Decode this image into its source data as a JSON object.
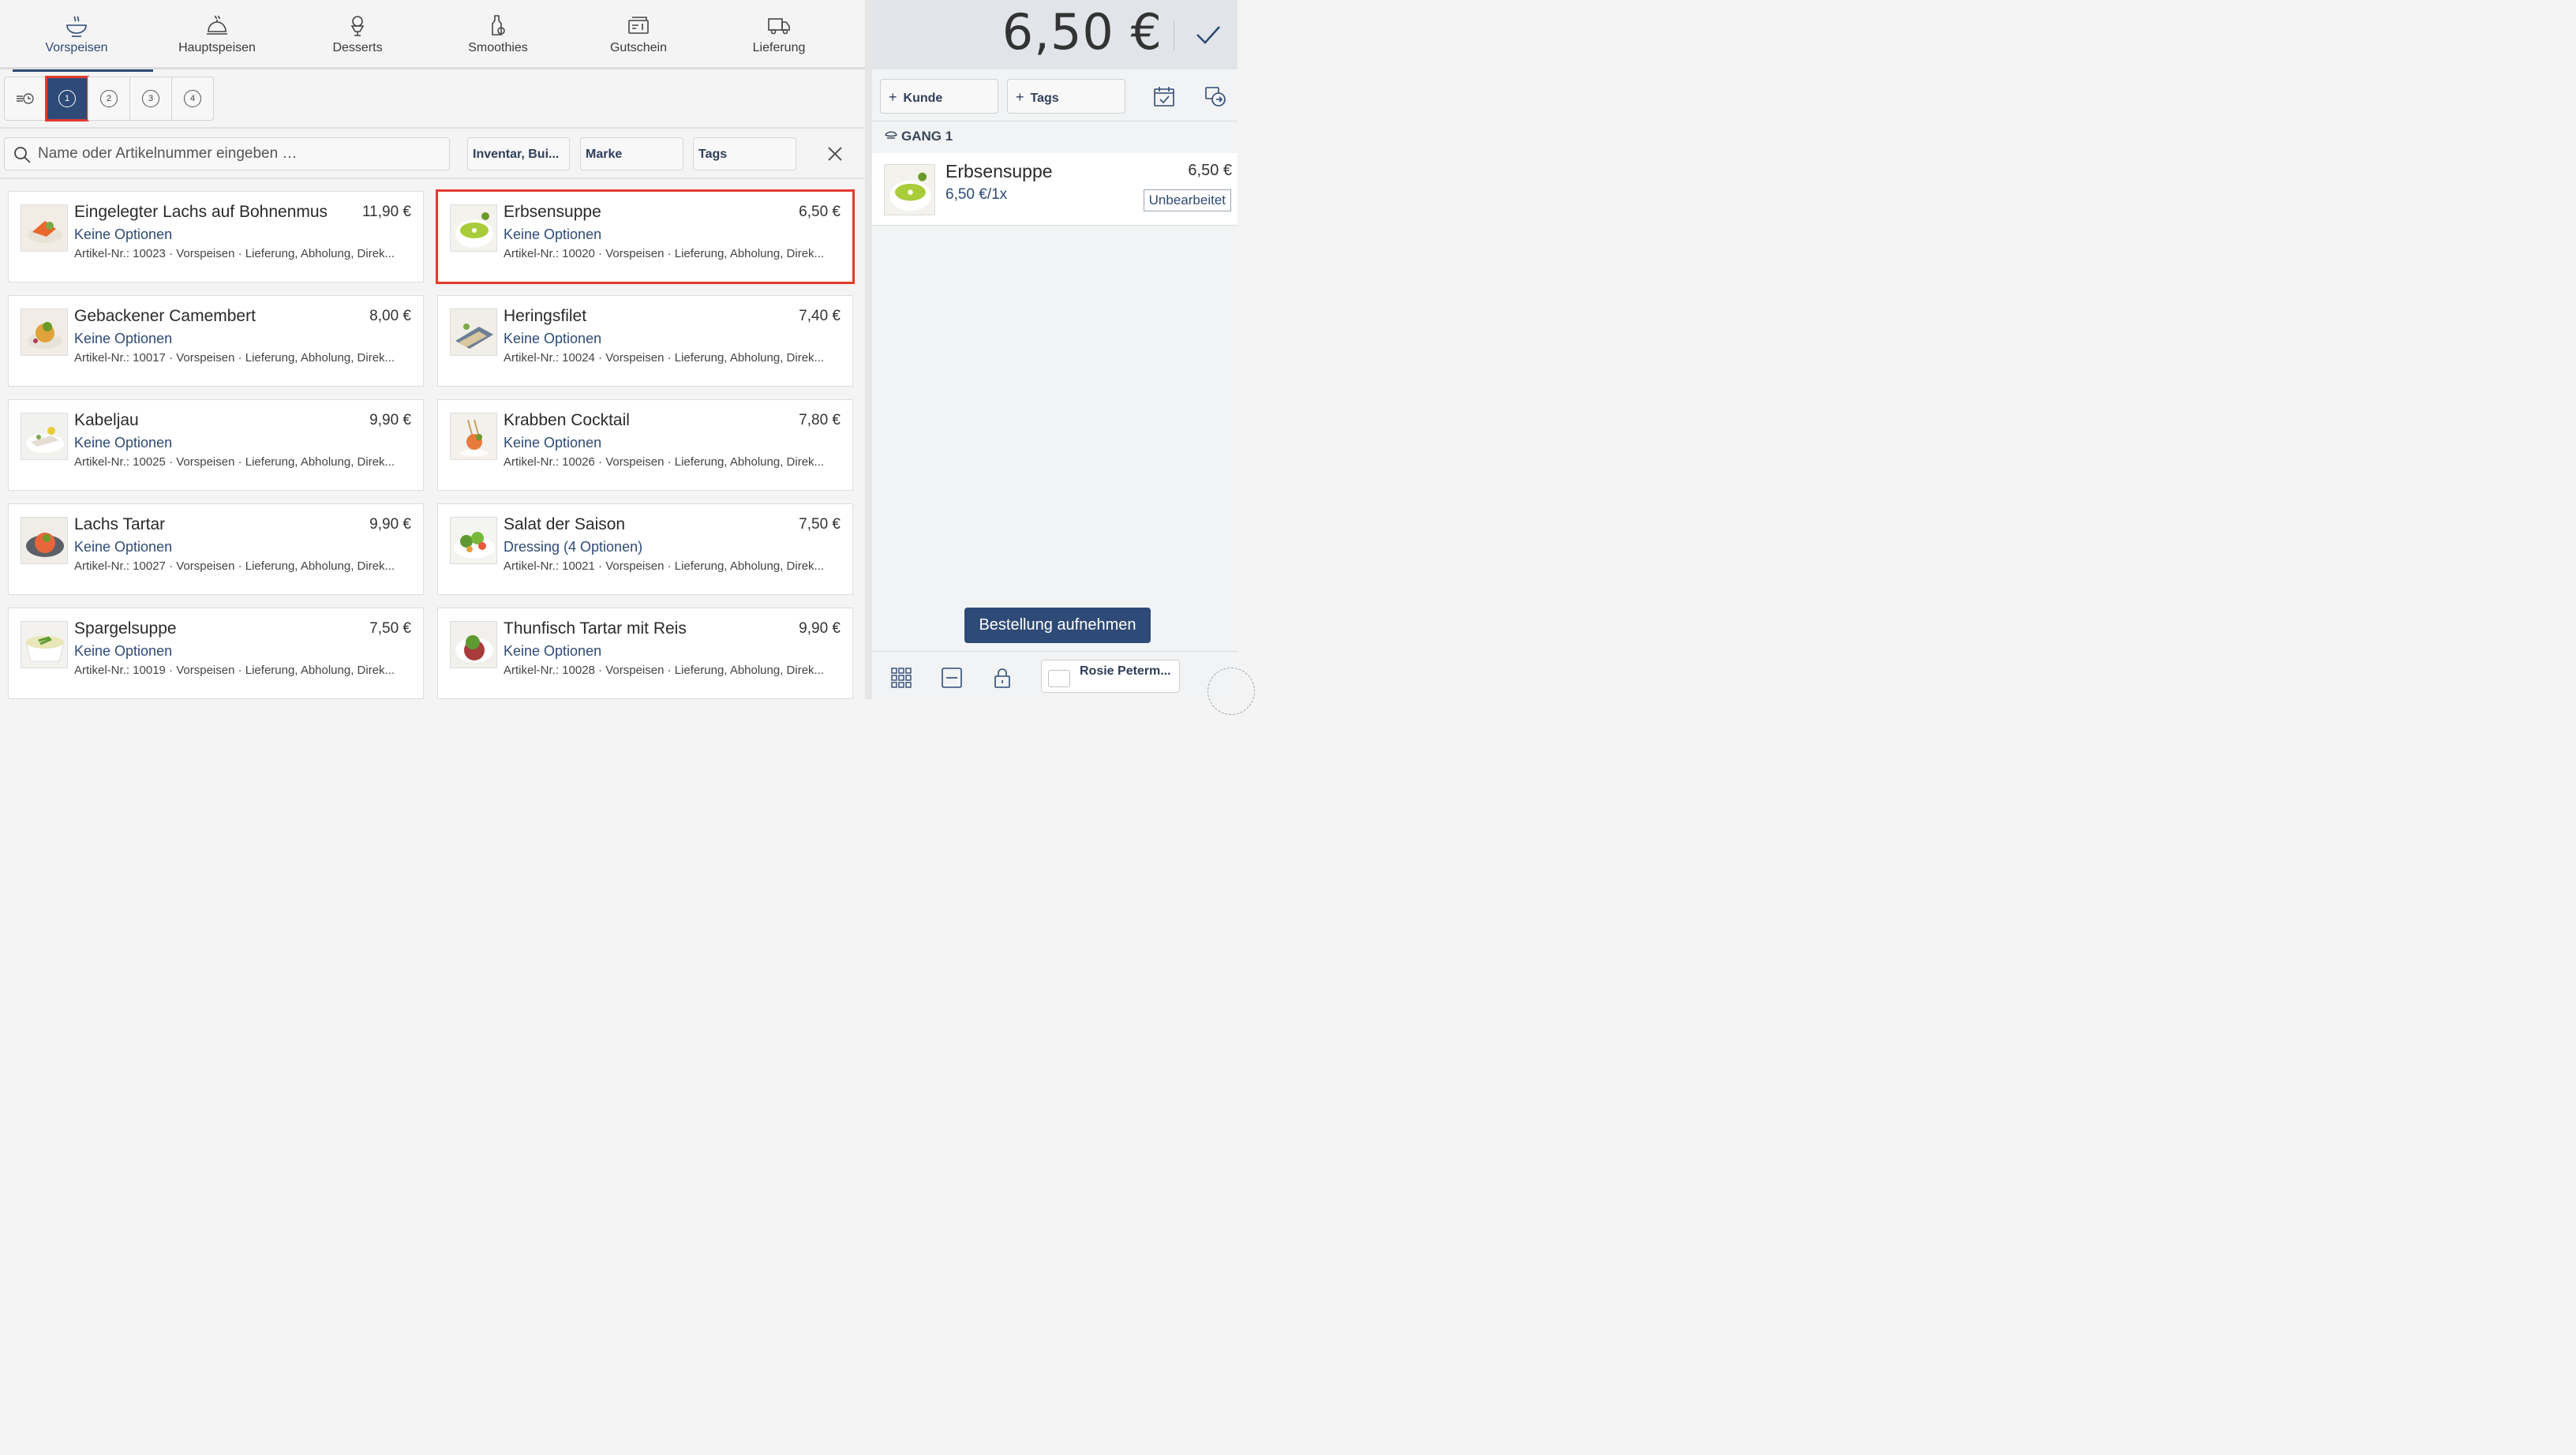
{
  "tabs": [
    {
      "label": "Vorspeisen",
      "icon": "soup-bowl-icon"
    },
    {
      "label": "Hauptspeisen",
      "icon": "cloche-icon"
    },
    {
      "label": "Desserts",
      "icon": "dessert-icon"
    },
    {
      "label": "Smoothies",
      "icon": "bottle-icon"
    },
    {
      "label": "Gutschein",
      "icon": "voucher-icon"
    },
    {
      "label": "Lieferung",
      "icon": "delivery-truck-icon"
    }
  ],
  "courses": [
    {
      "label": "",
      "icon": "list-clock-icon"
    },
    {
      "label": "1"
    },
    {
      "label": "2"
    },
    {
      "label": "3"
    },
    {
      "label": "4"
    }
  ],
  "search": {
    "placeholder": "Name oder Artikelnummer eingeben …"
  },
  "filters": {
    "category": "Inventar, Bui...",
    "brand": "Marke",
    "tags": "Tags"
  },
  "products": [
    {
      "name": "Eingelegter Lachs auf Bohnenmus",
      "price": "11,90 €",
      "options": "Keine Optionen",
      "meta": "Artikel-Nr.: 10023 · Vorspeisen · Lieferung, Abholung, Direk..."
    },
    {
      "name": "Erbsensuppe",
      "price": "6,50 €",
      "options": "Keine Optionen",
      "meta": "Artikel-Nr.: 10020 · Vorspeisen · Lieferung, Abholung, Direk..."
    },
    {
      "name": "Gebackener Camembert",
      "price": "8,00 €",
      "options": "Keine Optionen",
      "meta": "Artikel-Nr.: 10017 · Vorspeisen · Lieferung, Abholung, Direk..."
    },
    {
      "name": "Heringsfilet",
      "price": "7,40 €",
      "options": "Keine Optionen",
      "meta": "Artikel-Nr.: 10024 · Vorspeisen · Lieferung, Abholung, Direk..."
    },
    {
      "name": "Kabeljau",
      "price": "9,90 €",
      "options": "Keine Optionen",
      "meta": "Artikel-Nr.: 10025 · Vorspeisen · Lieferung, Abholung, Direk..."
    },
    {
      "name": "Krabben Cocktail",
      "price": "7,80 €",
      "options": "Keine Optionen",
      "meta": "Artikel-Nr.: 10026 · Vorspeisen · Lieferung, Abholung, Direk..."
    },
    {
      "name": "Lachs Tartar",
      "price": "9,90 €",
      "options": "Keine Optionen",
      "meta": "Artikel-Nr.: 10027 · Vorspeisen · Lieferung, Abholung, Direk..."
    },
    {
      "name": "Salat der Saison",
      "price": "7,50 €",
      "options": "Dressing (4 Optionen)",
      "meta": "Artikel-Nr.: 10021 · Vorspeisen · Lieferung, Abholung, Direk..."
    },
    {
      "name": "Spargelsuppe",
      "price": "7,50 €",
      "options": "Keine Optionen",
      "meta": "Artikel-Nr.: 10019 · Vorspeisen · Lieferung, Abholung, Direk..."
    },
    {
      "name": "Thunfisch Tartar mit Reis",
      "price": "9,90 €",
      "options": "Keine Optionen",
      "meta": "Artikel-Nr.: 10028 · Vorspeisen · Lieferung, Abholung, Direk..."
    }
  ],
  "order": {
    "total": "6,50 €",
    "customer_btn": "Kunde",
    "tags_btn": "Tags",
    "course_label": "GANG 1",
    "item": {
      "name": "Erbsensuppe",
      "qty": "6,50 €/1x",
      "price": "6,50 €",
      "status": "Unbearbeitet"
    },
    "submit": "Bestellung aufnehmen",
    "user": "Rosie Peterm..."
  },
  "colors": {
    "accent": "#2e4a76",
    "highlight": "#e53a2e"
  }
}
